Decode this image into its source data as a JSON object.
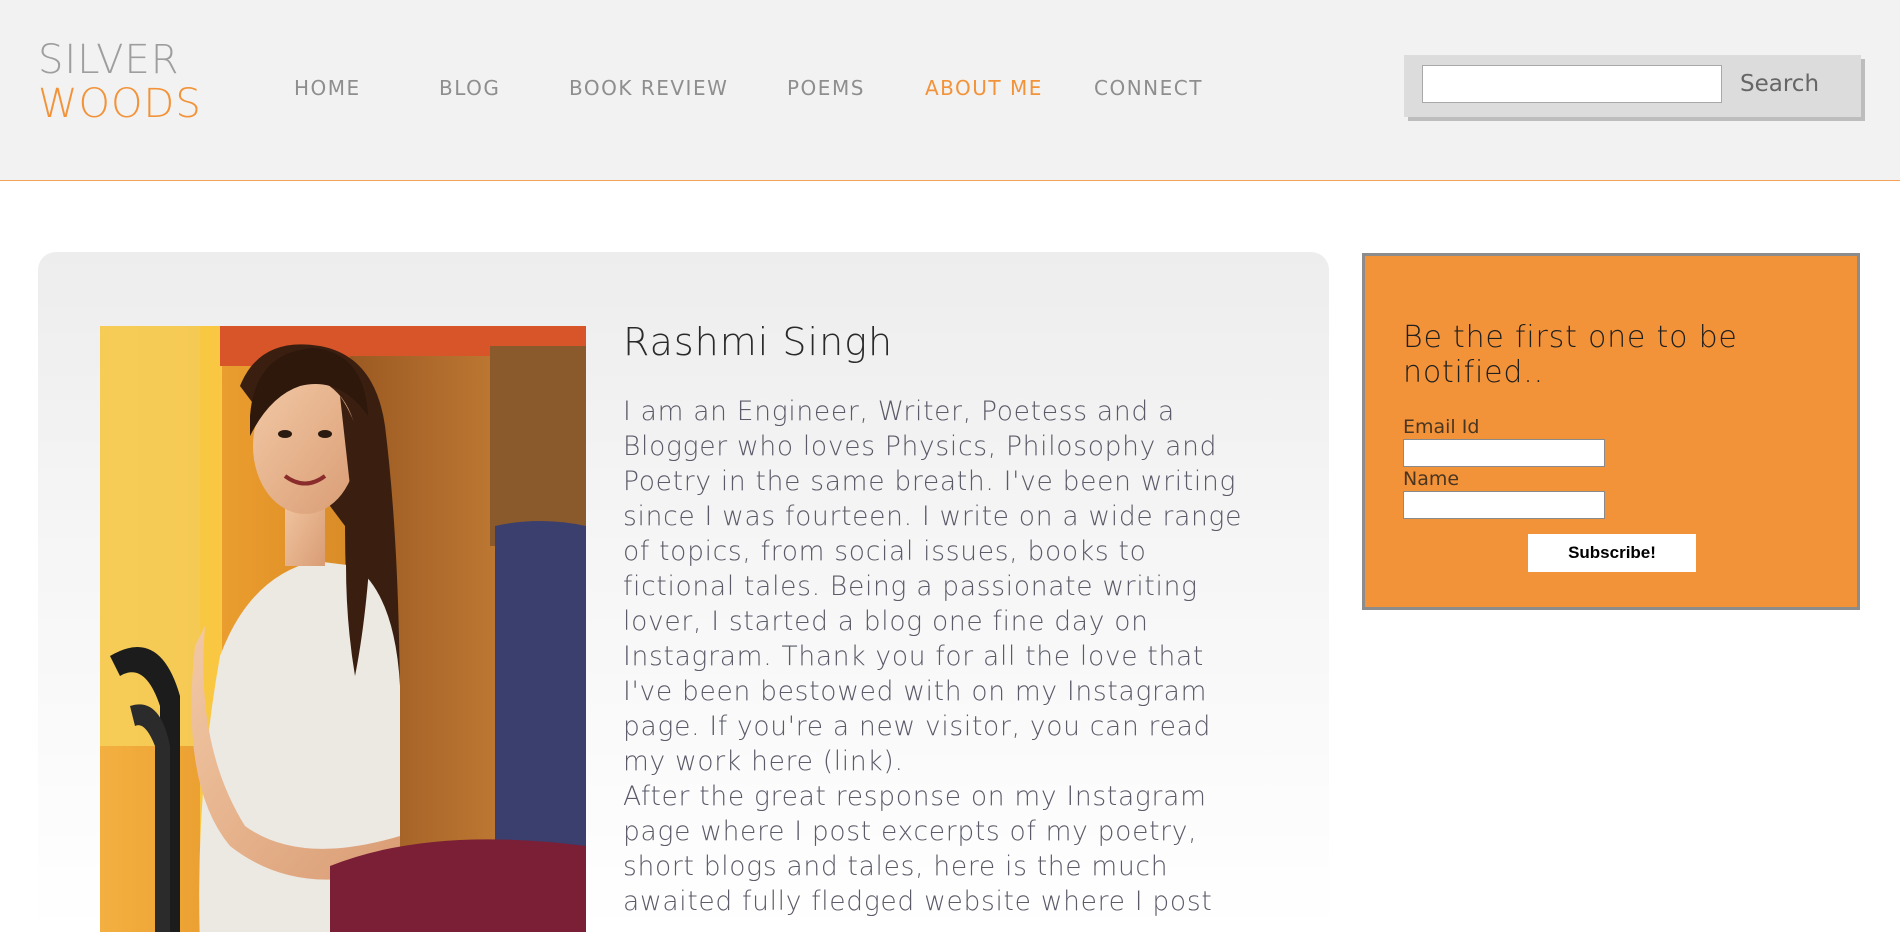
{
  "logo": {
    "line1": "SILVER",
    "line2": "WOODS"
  },
  "nav": {
    "items": [
      {
        "label": "HOME"
      },
      {
        "label": "BLOG"
      },
      {
        "label": "BOOK REVIEW"
      },
      {
        "label": "POEMS"
      },
      {
        "label": "ABOUT ME",
        "active": true
      },
      {
        "label": "CONNECT"
      }
    ]
  },
  "search": {
    "value": "",
    "placeholder": "",
    "button_label": "Search"
  },
  "about": {
    "photo_alt": "Rashmi Singh",
    "name": "Rashmi Singh",
    "lines": [
      "I am an Engineer, Writer, Poetess and a",
      "Blogger who loves Physics, Philosophy and",
      "Poetry in the same breath. I've been writing",
      "since I was fourteen. I write on a wide range",
      "of topics, from social issues, books to",
      "fictional tales. Being a passionate writing",
      "lover, I started a blog one fine day on",
      "Instagram. Thank you for all the love that",
      "I've been bestowed with on my Instagram",
      "page. If you're a new visitor, you can read",
      "my work here (link).",
      "After the great response on my Instagram",
      "page where I post excerpts of my poetry,",
      "short blogs and tales, here is the much",
      "awaited fully fledged website where I post"
    ]
  },
  "subscribe": {
    "heading": "Be the first one to be notified..",
    "email_label": "Email Id",
    "email_value": "",
    "name_label": "Name",
    "name_value": "",
    "button_label": "Subscribe!"
  },
  "colors": {
    "accent": "#f39339",
    "header_bg": "#f2f2f2",
    "nav_text": "#8e8e8e",
    "subscribe_bg": "#f39339"
  }
}
